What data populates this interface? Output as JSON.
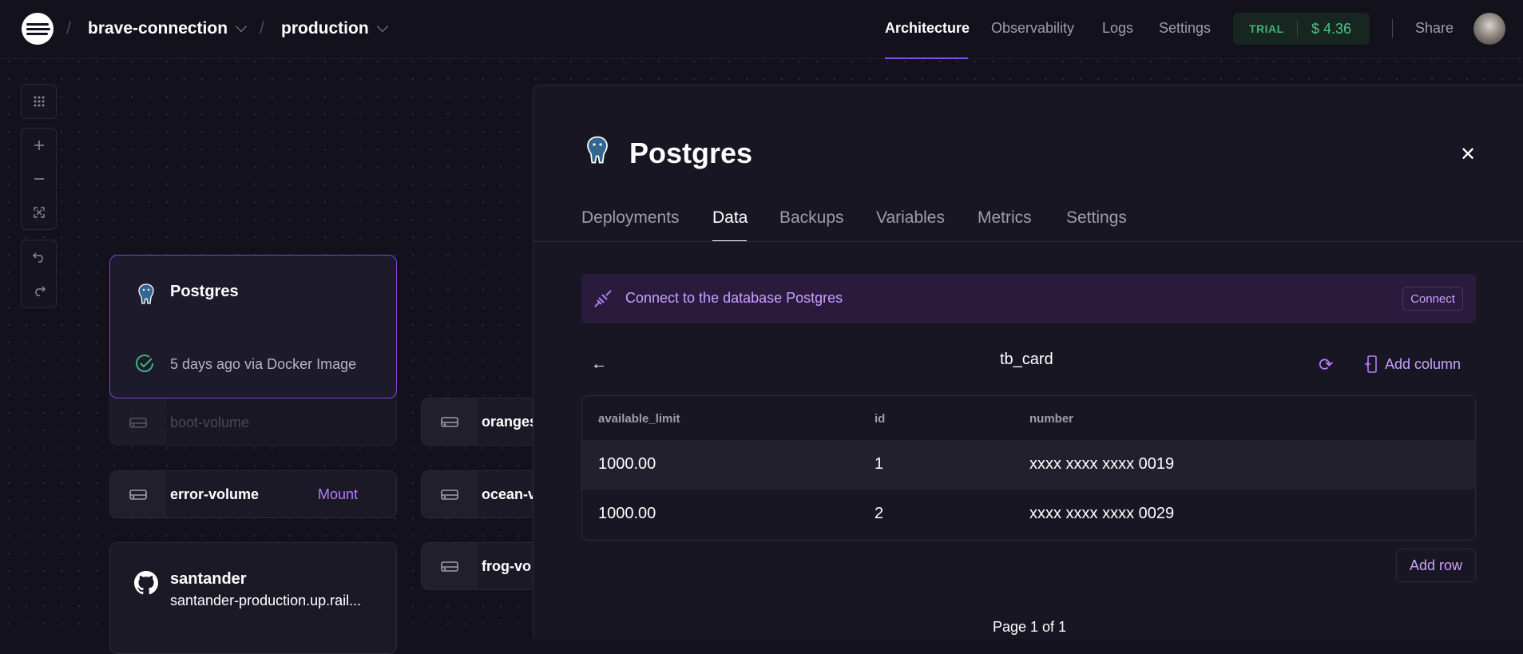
{
  "topbar": {
    "project": "brave-connection",
    "environment": "production",
    "nav": [
      "Architecture",
      "Observability",
      "Logs",
      "Settings"
    ],
    "trial_label": "TRIAL",
    "trial_amount": "$ 4.36",
    "share": "Share"
  },
  "canvas": {
    "postgres_card": {
      "title": "Postgres",
      "status": "5 days ago via Docker Image"
    },
    "volumes": {
      "boot": "boot-volume",
      "error": "error-volume",
      "mount": "Mount",
      "oranges": "oranges",
      "ocean": "ocean-v",
      "frog": "frog-vo"
    },
    "santander_card": {
      "title": "santander",
      "url": "santander-production.up.rail..."
    }
  },
  "panel": {
    "title": "Postgres",
    "tabs": [
      "Deployments",
      "Data",
      "Backups",
      "Variables",
      "Metrics",
      "Settings"
    ],
    "connect_text": "Connect to the database Postgres",
    "connect_button": "Connect",
    "table_name": "tb_card",
    "add_column": "Add column",
    "columns": [
      "available_limit",
      "id",
      "number"
    ],
    "rows": [
      [
        "1000.00",
        "1",
        "xxxx xxxx xxxx 0019"
      ],
      [
        "1000.00",
        "2",
        "xxxx xxxx xxxx 0029"
      ]
    ],
    "add_row": "Add row",
    "pagination": "Page 1 of 1"
  },
  "colors": {
    "accent": "#8a4cf5",
    "accent_text": "#c9a0ff",
    "trial_green": "#4bc28a",
    "background": "#13111c"
  }
}
